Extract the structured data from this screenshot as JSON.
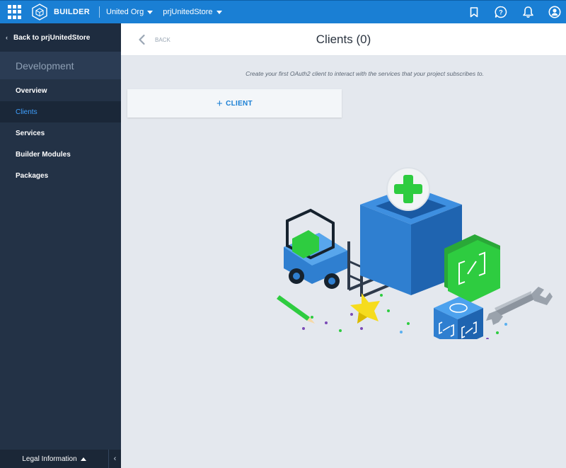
{
  "topbar": {
    "brand": "BUILDER",
    "org": "United Org",
    "store": "prjUnitedStore",
    "icons": [
      "apps-grid-icon",
      "builder-logo-icon",
      "bookmark-icon",
      "help-icon",
      "bell-icon",
      "user-icon"
    ]
  },
  "sidebar": {
    "back_label": "Back to prjUnitedStore",
    "section": "Development",
    "items": [
      {
        "label": "Overview"
      },
      {
        "label": "Clients"
      },
      {
        "label": "Services"
      },
      {
        "label": "Builder Modules"
      },
      {
        "label": "Packages"
      }
    ],
    "active_item": "Clients",
    "footer_label": "Legal Information"
  },
  "main": {
    "back_label": "BACK",
    "title": "Clients (0)",
    "hint": "Create your first OAuth2 client to interact with the services that your project subscribes to.",
    "add_client_label": "CLIENT"
  },
  "colors": {
    "accent": "#1a7fd4",
    "sidebar": "#233246",
    "active_text": "#3fa0ff",
    "background": "#e4e8ee",
    "illustration_green": "#2ecc40",
    "illustration_blue": "#2f7fd0"
  }
}
